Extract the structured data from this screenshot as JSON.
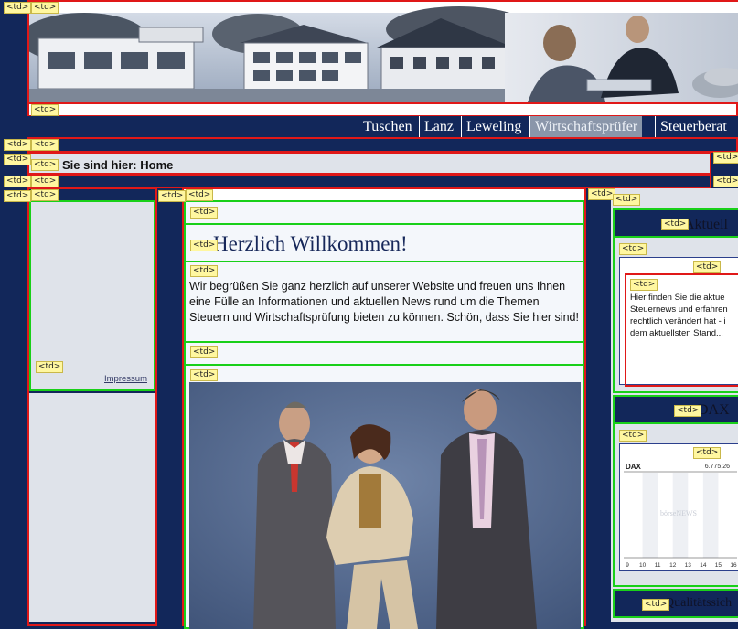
{
  "td_label": "<td>",
  "nav": {
    "items": [
      {
        "label": "Tuschen",
        "active": false
      },
      {
        "label": "Lanz",
        "active": false
      },
      {
        "label": "Leweling",
        "active": false
      },
      {
        "label": "Wirtschaftsprüfer",
        "active": true
      },
      {
        "label": "Steuerberat",
        "active": false
      }
    ]
  },
  "breadcrumb": "Sie sind hier: Home",
  "sidebar_left": {
    "link": "Impressum"
  },
  "main": {
    "heading": "Herzlich Willkommen!",
    "intro": "Wir begrüßen Sie ganz herzlich auf unserer Website und freuen uns Ihnen eine Fülle an Informationen und aktuellen News rund um die Themen Steuern und Wirtschaftsprüfung bieten zu können. Schön, dass Sie hier sind!"
  },
  "sidebar_right": {
    "news_heading": "Aktuell",
    "news_lines": [
      "Hier finden Sie die aktue",
      "Steuernews und erfahren",
      "rechtlich verändert hat - i",
      "dem aktuellsten Stand..."
    ],
    "dax_heading": "DAX",
    "dax_chart": {
      "title": "DAX",
      "value": "6.775,26",
      "watermark": "börseNEWS",
      "x_ticks": [
        "9",
        "10",
        "11",
        "12",
        "13",
        "14",
        "15",
        "16"
      ]
    },
    "quality_heading": "Qualitätssich"
  },
  "colors": {
    "navy": "#12275a",
    "red_outline": "#e01818",
    "green_outline": "#19d019",
    "label_bg": "#fff7a0"
  }
}
